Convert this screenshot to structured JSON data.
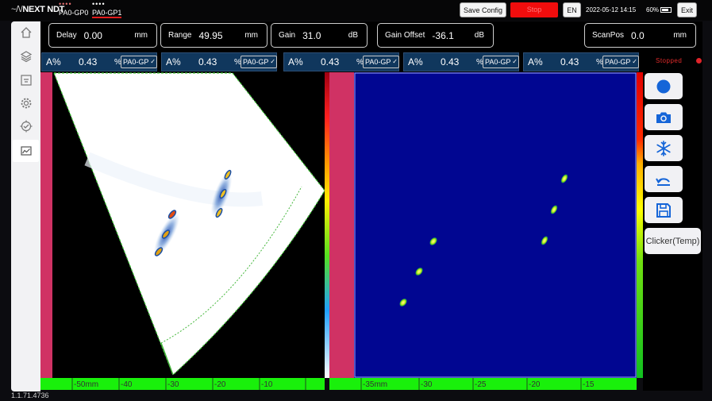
{
  "topbar": {
    "logo_text": "NEXT NDT",
    "groups": [
      {
        "label": "PA0-GP0",
        "active": false
      },
      {
        "label": "PA0-GP1",
        "active": true
      }
    ],
    "save_config_label": "Save Config",
    "stop_label": "Stop",
    "language_label": "EN",
    "datetime": "2022-05-12 14:15",
    "battery": "60%",
    "exit_label": "Exit"
  },
  "params": [
    {
      "name": "Delay",
      "value": "0.00",
      "unit": "mm"
    },
    {
      "name": "Range",
      "value": "49.95",
      "unit": "mm"
    },
    {
      "name": "Gain",
      "value": "31.0",
      "unit": "dB"
    },
    {
      "name": "Gain Offset",
      "value": "-36.1",
      "unit": "dB"
    },
    {
      "name": "ScanPos",
      "value": "0.0",
      "unit": "mm"
    }
  ],
  "gates": [
    {
      "label": "A%",
      "value": "0.43",
      "unit": "%",
      "source": "PA0-GP"
    },
    {
      "label": "A%",
      "value": "0.43",
      "unit": "%",
      "source": "PA0-GP"
    },
    {
      "label": "A%",
      "value": "0.43",
      "unit": "%",
      "source": "PA0-GP"
    },
    {
      "label": "A%",
      "value": "0.43",
      "unit": "%",
      "source": "PA0-GP"
    },
    {
      "label": "A%",
      "value": "0.43",
      "unit": "%",
      "source": "PA0-GP"
    }
  ],
  "status": "Stopped",
  "tools": {
    "clicker_label": "Clicker(Temp)"
  },
  "sector_scan": {
    "ruler_ticks": [
      "-50mm",
      "-40",
      "-30",
      "-20",
      "-10"
    ]
  },
  "cscan": {
    "ruler_ticks": [
      "-35mm",
      "-30",
      "-25",
      "-20",
      "-15"
    ]
  },
  "version": "1.1.71.4736",
  "colors": {
    "accent_red": "#e21c1c",
    "ruler_green": "#19f00b",
    "ruler_pink": "#d03264",
    "gate_blue": "#10375d",
    "cscan_bg": "#010691",
    "indication_yellow": "#e6f542"
  }
}
